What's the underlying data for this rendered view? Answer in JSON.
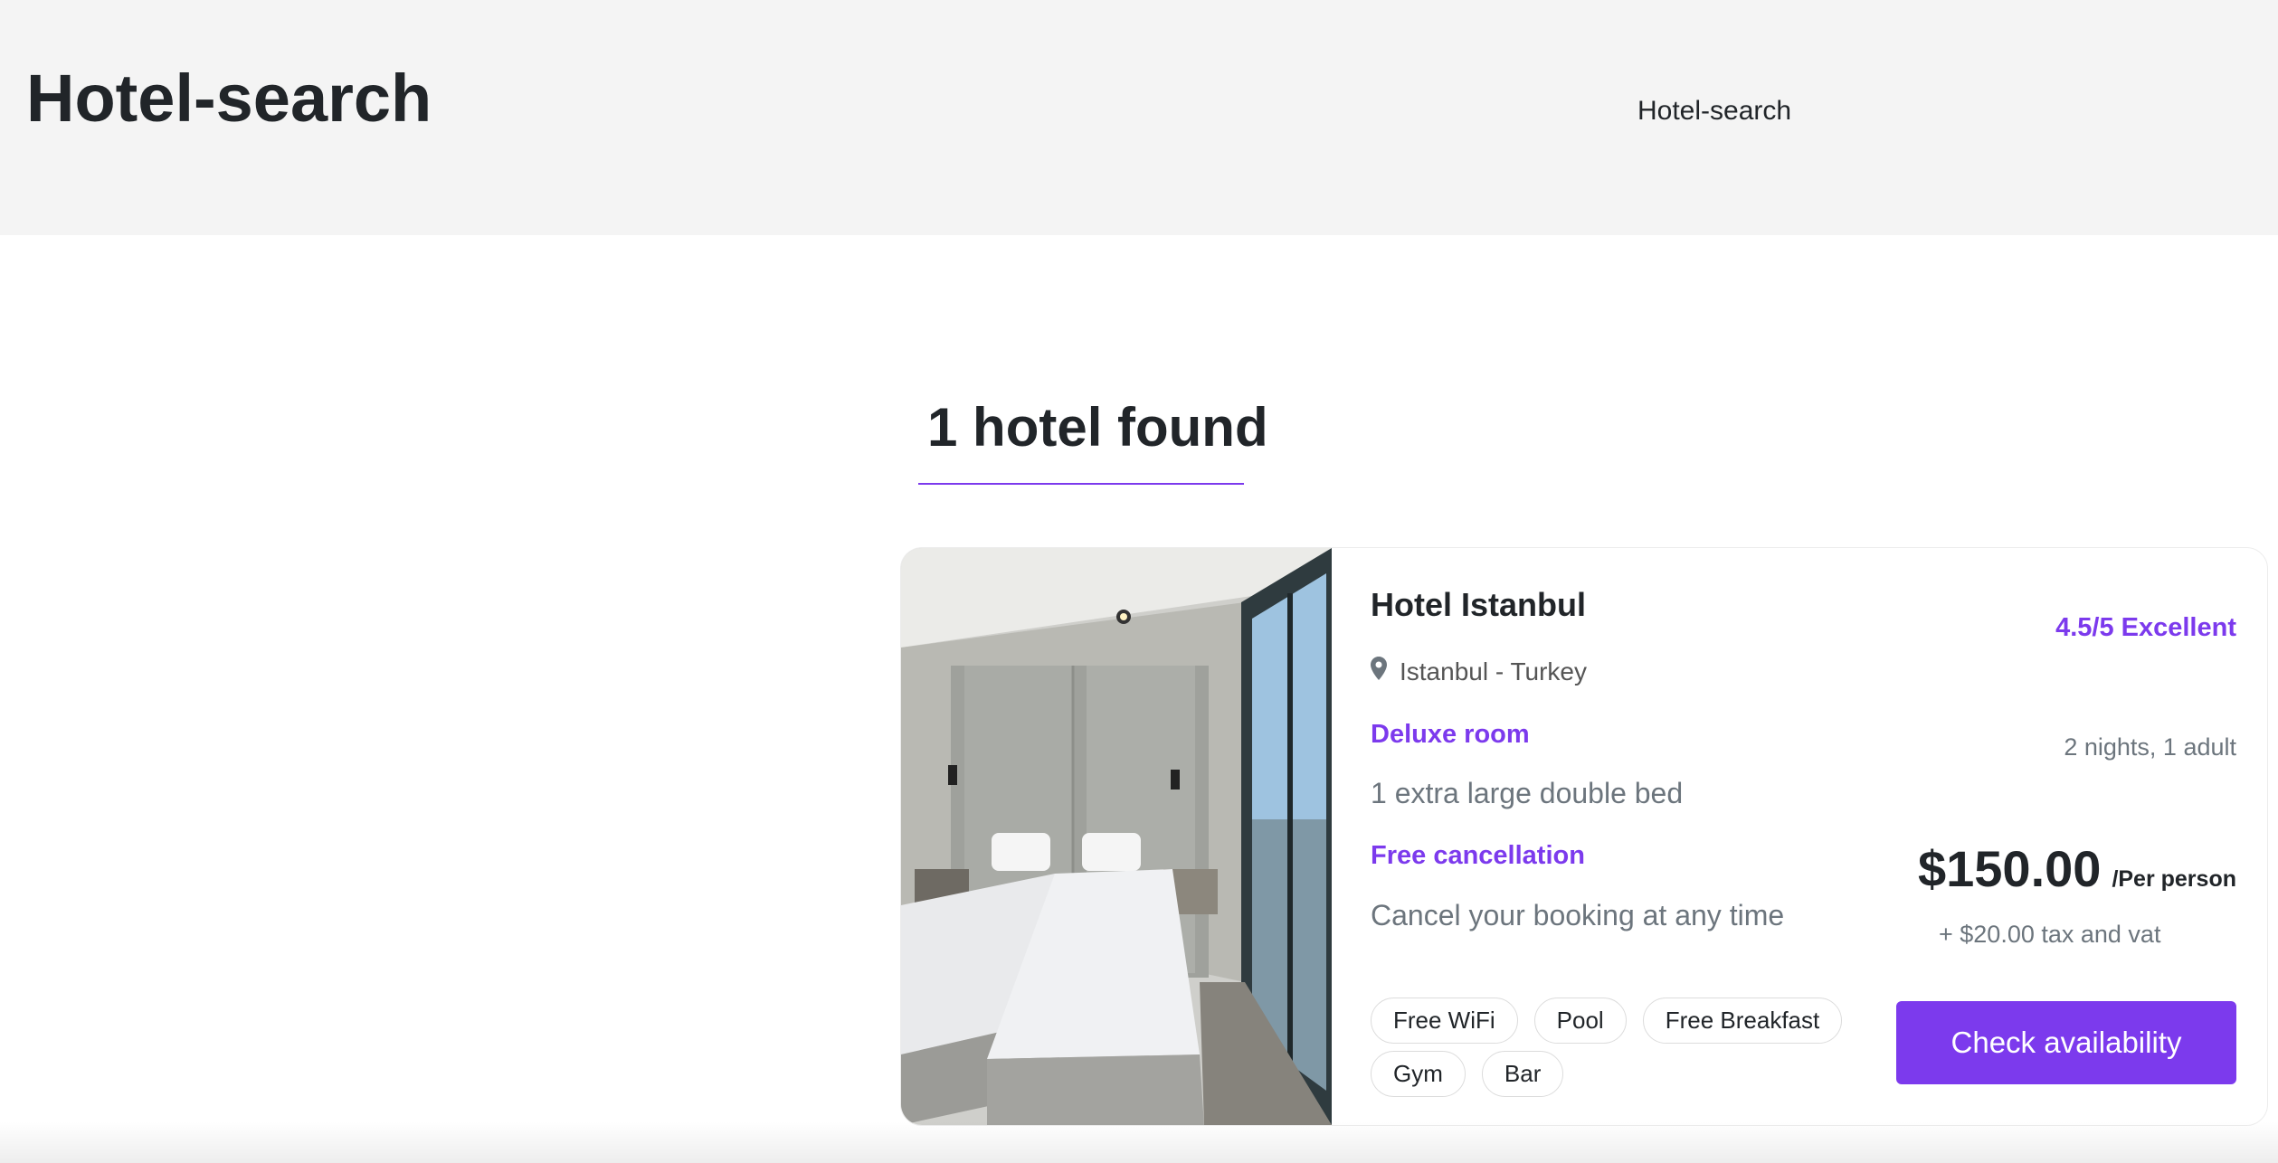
{
  "header": {
    "brand": "Hotel-search",
    "nav_link": "Hotel-search"
  },
  "results": {
    "heading": "1 hotel found"
  },
  "hotel": {
    "name": "Hotel Istanbul",
    "location": "Istanbul - Turkey",
    "room_type": "Deluxe room",
    "bed": "1 extra large double bed",
    "cancellation_title": "Free cancellation",
    "cancellation_desc": "Cancel your booking at any time",
    "amenities": [
      "Free WiFi",
      "Pool",
      "Free Breakfast",
      "Gym",
      "Bar"
    ],
    "rating": "4.5/5 Excellent",
    "stay": "2 nights, 1 adult",
    "price": "$150.00",
    "per": "/Per person",
    "tax": "+ $20.00 tax and vat",
    "cta": "Check availability",
    "image_icon": "hotel-room-photo",
    "location_icon": "map-pin-icon"
  },
  "colors": {
    "accent": "#7c3aed",
    "header_bg": "#f4f4f4"
  }
}
